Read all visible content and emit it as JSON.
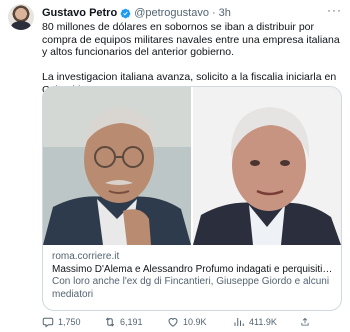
{
  "tweet": {
    "author_name": "Gustavo Petro",
    "handle": "@petrogustavo",
    "separator": "·",
    "time": "3h",
    "more_icon": "more-horizontal-icon",
    "verified_color": "#1d9bf0",
    "paragraphs": [
      "80 millones de dólares en sobornos se iban a distribuir por compra de equipos militares navales entre una empresa italiana y altos funcionarios del anterior gobierno.",
      "La investigacion italiana avanza, solicito a la fiscalia iniciarla en Colombia."
    ]
  },
  "card": {
    "domain": "roma.corriere.it",
    "title": "Massimo D'Alema e Alessandro Profumo indagati e perquisiti per la ...",
    "description": "Con loro anche l'ex dg di Fincantieri, Giuseppe Giordo e alcuni mediatori"
  },
  "actions": {
    "replies": "1,750",
    "retweets": "6,191",
    "likes": "10.9K",
    "views": "411.9K",
    "icons": [
      "reply-icon",
      "retweet-icon",
      "like-icon",
      "views-icon",
      "share-icon"
    ]
  }
}
